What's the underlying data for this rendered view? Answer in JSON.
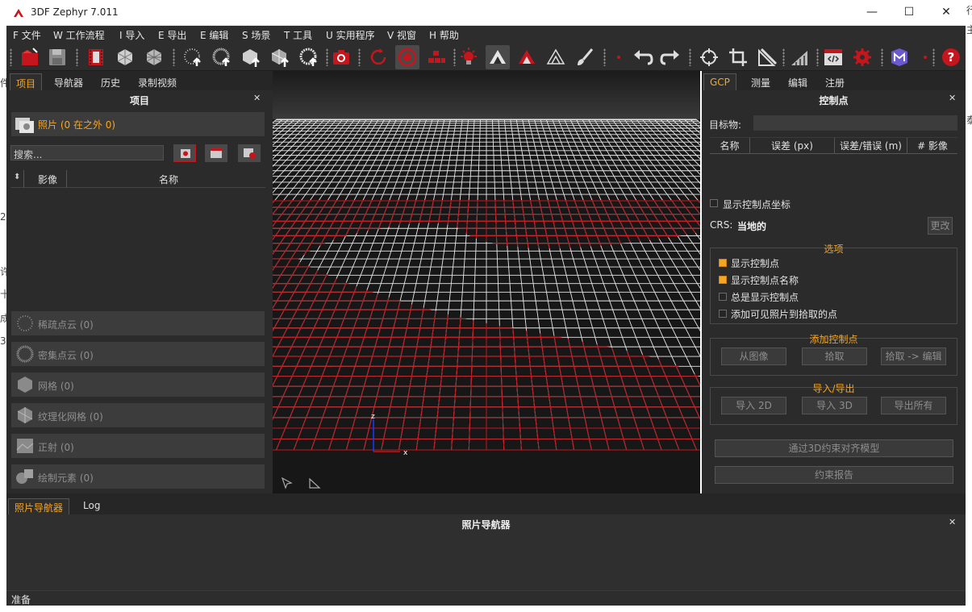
{
  "window": {
    "title": "3DF Zephyr 7.011",
    "minimize": "—",
    "maximize": "☐",
    "close": "✕"
  },
  "menu": [
    "F 文件",
    "W 工作流程",
    "I 导入",
    "E 导出",
    "E 编辑",
    "S 场景",
    "T 工具",
    "U 实用程序",
    "V 视窗",
    "H 帮助"
  ],
  "toolbar_icons": [
    "new-project-icon",
    "save-icon",
    "film-icon",
    "mesh-icon",
    "mesh-icon",
    "sparse-cloud-icon",
    "dense-cloud-icon",
    "mesh-upload-icon",
    "textured-mesh-icon",
    "pointcloud-upload-icon",
    "camera-icon",
    "rotate-icon",
    "record-icon",
    "grid-icon",
    "light-icon",
    "triangle-icon",
    "triangle-red-icon",
    "triangle-outline-icon",
    "brush-icon",
    "undo-icon",
    "redo-icon",
    "orbit-icon",
    "crop-icon",
    "measure-icon",
    "chart-icon",
    "script-icon",
    "settings-icon",
    "logo-icon",
    "help-icon"
  ],
  "left": {
    "tabs": [
      "项目",
      "导航器",
      "历史",
      "录制视频"
    ],
    "title": "项目",
    "photos_label": "照片 (0 在之外 0)",
    "search_placeholder": "搜索...",
    "columns": {
      "image": "影像",
      "name": "名称"
    },
    "sections": [
      "稀疏点云 (0)",
      "密集点云 (0)",
      "网格 (0)",
      "纹理化网格 (0)",
      "正射 (0)",
      "绘制元素 (0)"
    ]
  },
  "viewport": {
    "axis_z": "z",
    "axis_x": "x"
  },
  "right": {
    "tabs": [
      "GCP",
      "测量",
      "编辑",
      "注册"
    ],
    "title": "控制点",
    "target_label": "目标物:",
    "columns": [
      "名称",
      "误差 (px)",
      "误差/错误 (m)",
      "# 影像"
    ],
    "show_coords": "显示控制点坐标",
    "crs_label": "CRS:",
    "crs_value": "当地的",
    "change_btn": "更改",
    "options_title": "选项",
    "options": [
      {
        "label": "显示控制点",
        "checked": true
      },
      {
        "label": "显示控制点名称",
        "checked": true
      },
      {
        "label": "总是显示控制点",
        "checked": false
      },
      {
        "label": "添加可见照片到拾取的点",
        "checked": false
      }
    ],
    "add_title": "添加控制点",
    "add_buttons": [
      "从图像",
      "拾取",
      "拾取 -> 编辑"
    ],
    "io_title": "导入/导出",
    "io_buttons": [
      "导入 2D",
      "导入 3D",
      "导出所有"
    ],
    "align_btn": "通过3D约束对齐模型",
    "report_btn": "约束报告"
  },
  "bottom": {
    "tabs": [
      "照片导航器",
      "Log"
    ],
    "title": "照片导航器",
    "status": "准备"
  },
  "colors": {
    "accent": "#f5a623",
    "grid_red": "#c4161c"
  }
}
